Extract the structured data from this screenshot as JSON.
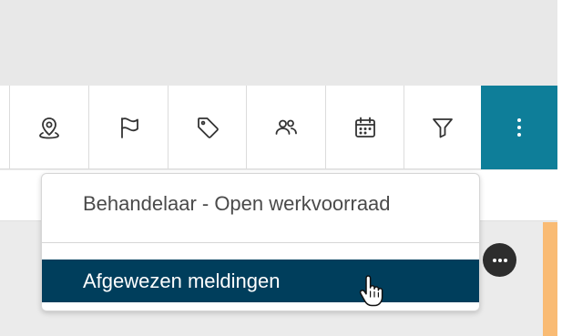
{
  "toolbar": {
    "buttons": [
      {
        "name": "location-pin-icon",
        "tooltip": ""
      },
      {
        "name": "flag-icon",
        "tooltip": ""
      },
      {
        "name": "tag-icon",
        "tooltip": ""
      },
      {
        "name": "users-icon",
        "tooltip": ""
      },
      {
        "name": "calendar-icon",
        "tooltip": ""
      },
      {
        "name": "filter-icon",
        "tooltip": ""
      },
      {
        "name": "more-vertical-icon",
        "tooltip": ""
      }
    ],
    "accent_color": "#0e7e99"
  },
  "dropdown": {
    "items": [
      {
        "label": "Behandelaar - Open werkvoorraad"
      },
      {
        "label": "Afgewezen meldingen"
      }
    ],
    "active_color": "#003e5c"
  },
  "colors": {
    "status_bar": "#f9bb74",
    "more_circle": "#2d2d2d"
  },
  "icons": {
    "more_horizontal": "more-horizontal-icon",
    "cursor": "hand-pointer-icon"
  }
}
